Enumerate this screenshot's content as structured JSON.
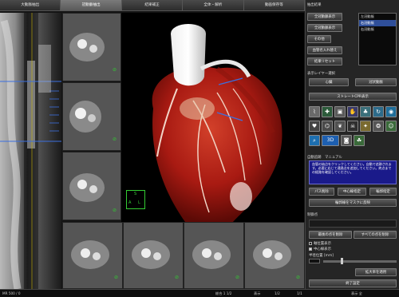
{
  "tabs": [
    {
      "label": "大動脈抽出"
    },
    {
      "label": "冠動脈抽出"
    },
    {
      "label": "結果補正"
    },
    {
      "label": "全体・解析"
    },
    {
      "label": "動画保存等"
    }
  ],
  "panel": {
    "section_result": "抽出結果",
    "buttons_top": [
      "全冠動脈表示",
      "全冠動脈表示",
      "その他",
      "血管名入れ替え",
      "結果リセット"
    ],
    "list_items": [
      "左冠動脈",
      "右冠動脈",
      "右冠動脈"
    ],
    "section_display": "表示レイヤー選択",
    "layer_buttons": [
      "心臓",
      "冠状動脈"
    ],
    "straight_button": "ストレートCPR表示",
    "section_auto": "自動追跡",
    "section_manual": "マニュアル",
    "instructions": "血管の始点をクリックしてください。自動で追跡されます。必要に応じて通過点を追加してください。終点までの経路を確認してください。",
    "bottom_buttons": [
      "パス削除",
      "中心線指定",
      "輪郭指定"
    ],
    "contour_button": "輪郭線をマスクに反映",
    "section_control": "制御点",
    "control_buttons": [
      "最後の点を削除",
      "すべての点を削除"
    ],
    "checkbox_1": "軸位置表示",
    "checkbox_2": "中心線表示",
    "radius_label": "半径位置 [mm]",
    "apply_button": "拡大率を適用",
    "finish_button": "終了設定"
  },
  "icons": [
    "vessel-icon",
    "crosshair-icon",
    "cube-icon",
    "pan-icon",
    "tree-icon",
    "heart-icon",
    "network-icon",
    "lung-icon",
    "skeleton-icon",
    "mesh-icon",
    "fat-icon",
    "3d-icon",
    "camera-icon",
    "film-icon"
  ],
  "icon_3d_text": "3D",
  "cube_labels": {
    "top": "S",
    "left": "A",
    "right": "L"
  },
  "statusbar": {
    "left": "MR 500 / 0",
    "right_items": [
      "総合 1 1/2",
      "表示",
      "1/2",
      "1/1",
      "表示 全"
    ]
  },
  "colors": {
    "accent": "#ffcc00",
    "vessel_line": "#3b6fe0",
    "heart": "#a81a12"
  }
}
